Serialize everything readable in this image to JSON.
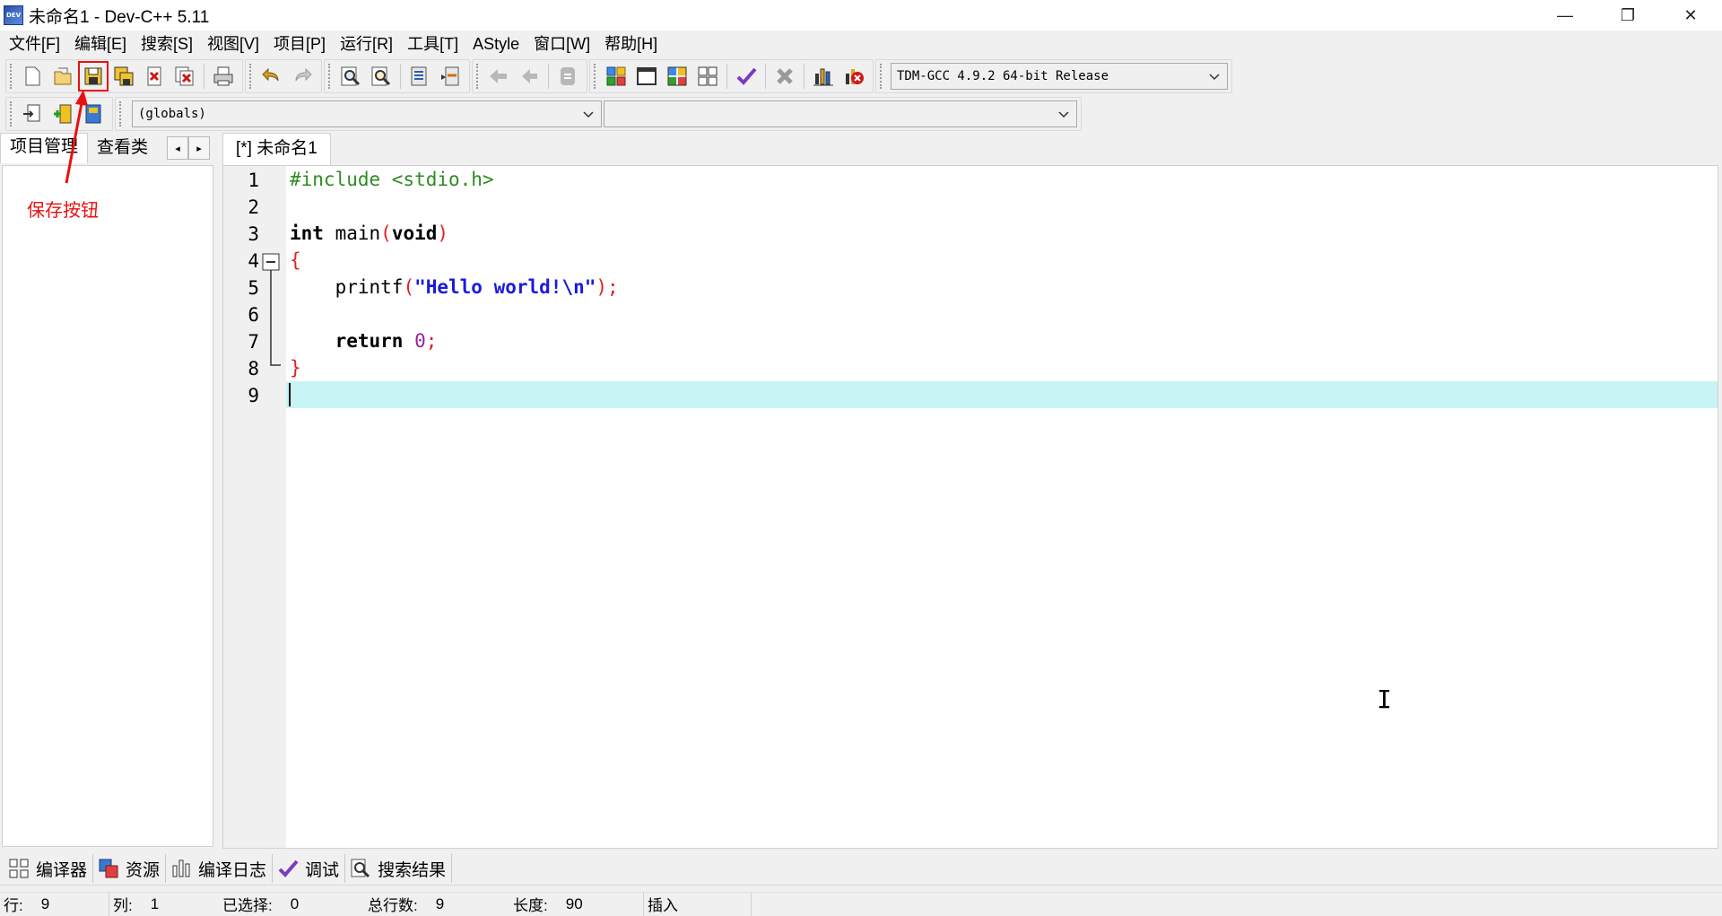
{
  "window": {
    "title": "未命名1 - Dev-C++ 5.11",
    "logo_text": "DEV"
  },
  "window_controls": {
    "minimize": "—",
    "maximize": "❐",
    "close": "✕"
  },
  "menu": [
    "文件[F]",
    "编辑[E]",
    "搜索[S]",
    "视图[V]",
    "项目[P]",
    "运行[R]",
    "工具[T]",
    "AStyle",
    "窗口[W]",
    "帮助[H]"
  ],
  "toolbar": {
    "compiler": "TDM-GCC 4.9.2 64-bit Release",
    "scope": "(globals)",
    "function": ""
  },
  "left_panel": {
    "tabs": [
      "项目管理",
      "查看类"
    ],
    "scroll_left": "◂",
    "scroll_right": "▸",
    "annotation": "保存按钮"
  },
  "editor": {
    "tab": "[*] 未命名1",
    "line_numbers": [
      "1",
      "2",
      "3",
      "4",
      "5",
      "6",
      "7",
      "8",
      "9"
    ],
    "code": {
      "l1": "#include <stdio.h>",
      "l3_kw": "int",
      "l3_name": " main",
      "l3_open": "(",
      "l3_void": "void",
      "l3_close": ")",
      "l4": "{",
      "l5_indent": "    printf",
      "l5_open": "(",
      "l5_str": "\"Hello world!\\n\"",
      "l5_close": ");",
      "l7_indent": "    ",
      "l7_kw": "return",
      "l7_space": " ",
      "l7_num": "0",
      "l7_semi": ";",
      "l8": "}"
    },
    "cursor_line": 9
  },
  "bottom_tabs": [
    "编译器",
    "资源",
    "编译日志",
    "调试",
    "搜索结果"
  ],
  "status": {
    "row_label": "行:",
    "row_value": "9",
    "col_label": "列:",
    "col_value": "1",
    "sel_label": "已选择:",
    "sel_value": "0",
    "total_label": "总行数:",
    "total_value": "9",
    "len_label": "长度:",
    "len_value": "90",
    "mode": "插入"
  },
  "colors": {
    "annotation": "#e81010",
    "current_line": "#c8f4f6",
    "preprocessor": "#2e8b22",
    "string": "#1a1ae0",
    "bracket": "#e02020",
    "number": "#a020a0"
  }
}
